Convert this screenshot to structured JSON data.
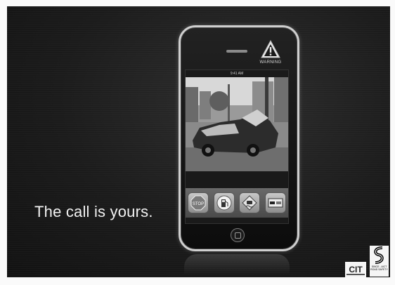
{
  "tagline": "The call is yours.",
  "phone": {
    "warning_label": "WARNING",
    "status_time": "9:41 AM",
    "photo_description_icon": "crashed-car-photo",
    "app_icons": [
      {
        "label": "STOP",
        "icon": "stop-sign-icon"
      },
      {
        "label": "",
        "icon": "gas-pump-icon"
      },
      {
        "label": "",
        "icon": "slippery-road-icon"
      },
      {
        "label": "",
        "icon": "no-overtaking-icon"
      }
    ]
  },
  "logos": {
    "cit": "CIT",
    "road_safety": "SINCE - AICT ROAD SAFETY"
  },
  "colors": {
    "background": "#1b1b1b",
    "text": "#f2f2f2"
  }
}
